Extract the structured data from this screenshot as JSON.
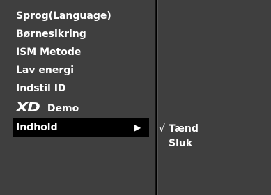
{
  "menu": {
    "items": [
      {
        "label": "Sprog(Language)"
      },
      {
        "label": "Børnesikring"
      },
      {
        "label": "ISM Metode"
      },
      {
        "label": "Lav energi"
      },
      {
        "label": "Indstil ID"
      },
      {
        "label": "Demo",
        "logo": "XD"
      },
      {
        "label": "Indhold",
        "selected": true,
        "arrow": "▶"
      }
    ]
  },
  "submenu": {
    "items": [
      {
        "label": "Tænd",
        "checked": true,
        "check": "√"
      },
      {
        "label": "Sluk",
        "checked": false
      }
    ]
  },
  "colors": {
    "panel": "#3f3f3f",
    "highlight": "#000000",
    "text": "#ffffff"
  }
}
